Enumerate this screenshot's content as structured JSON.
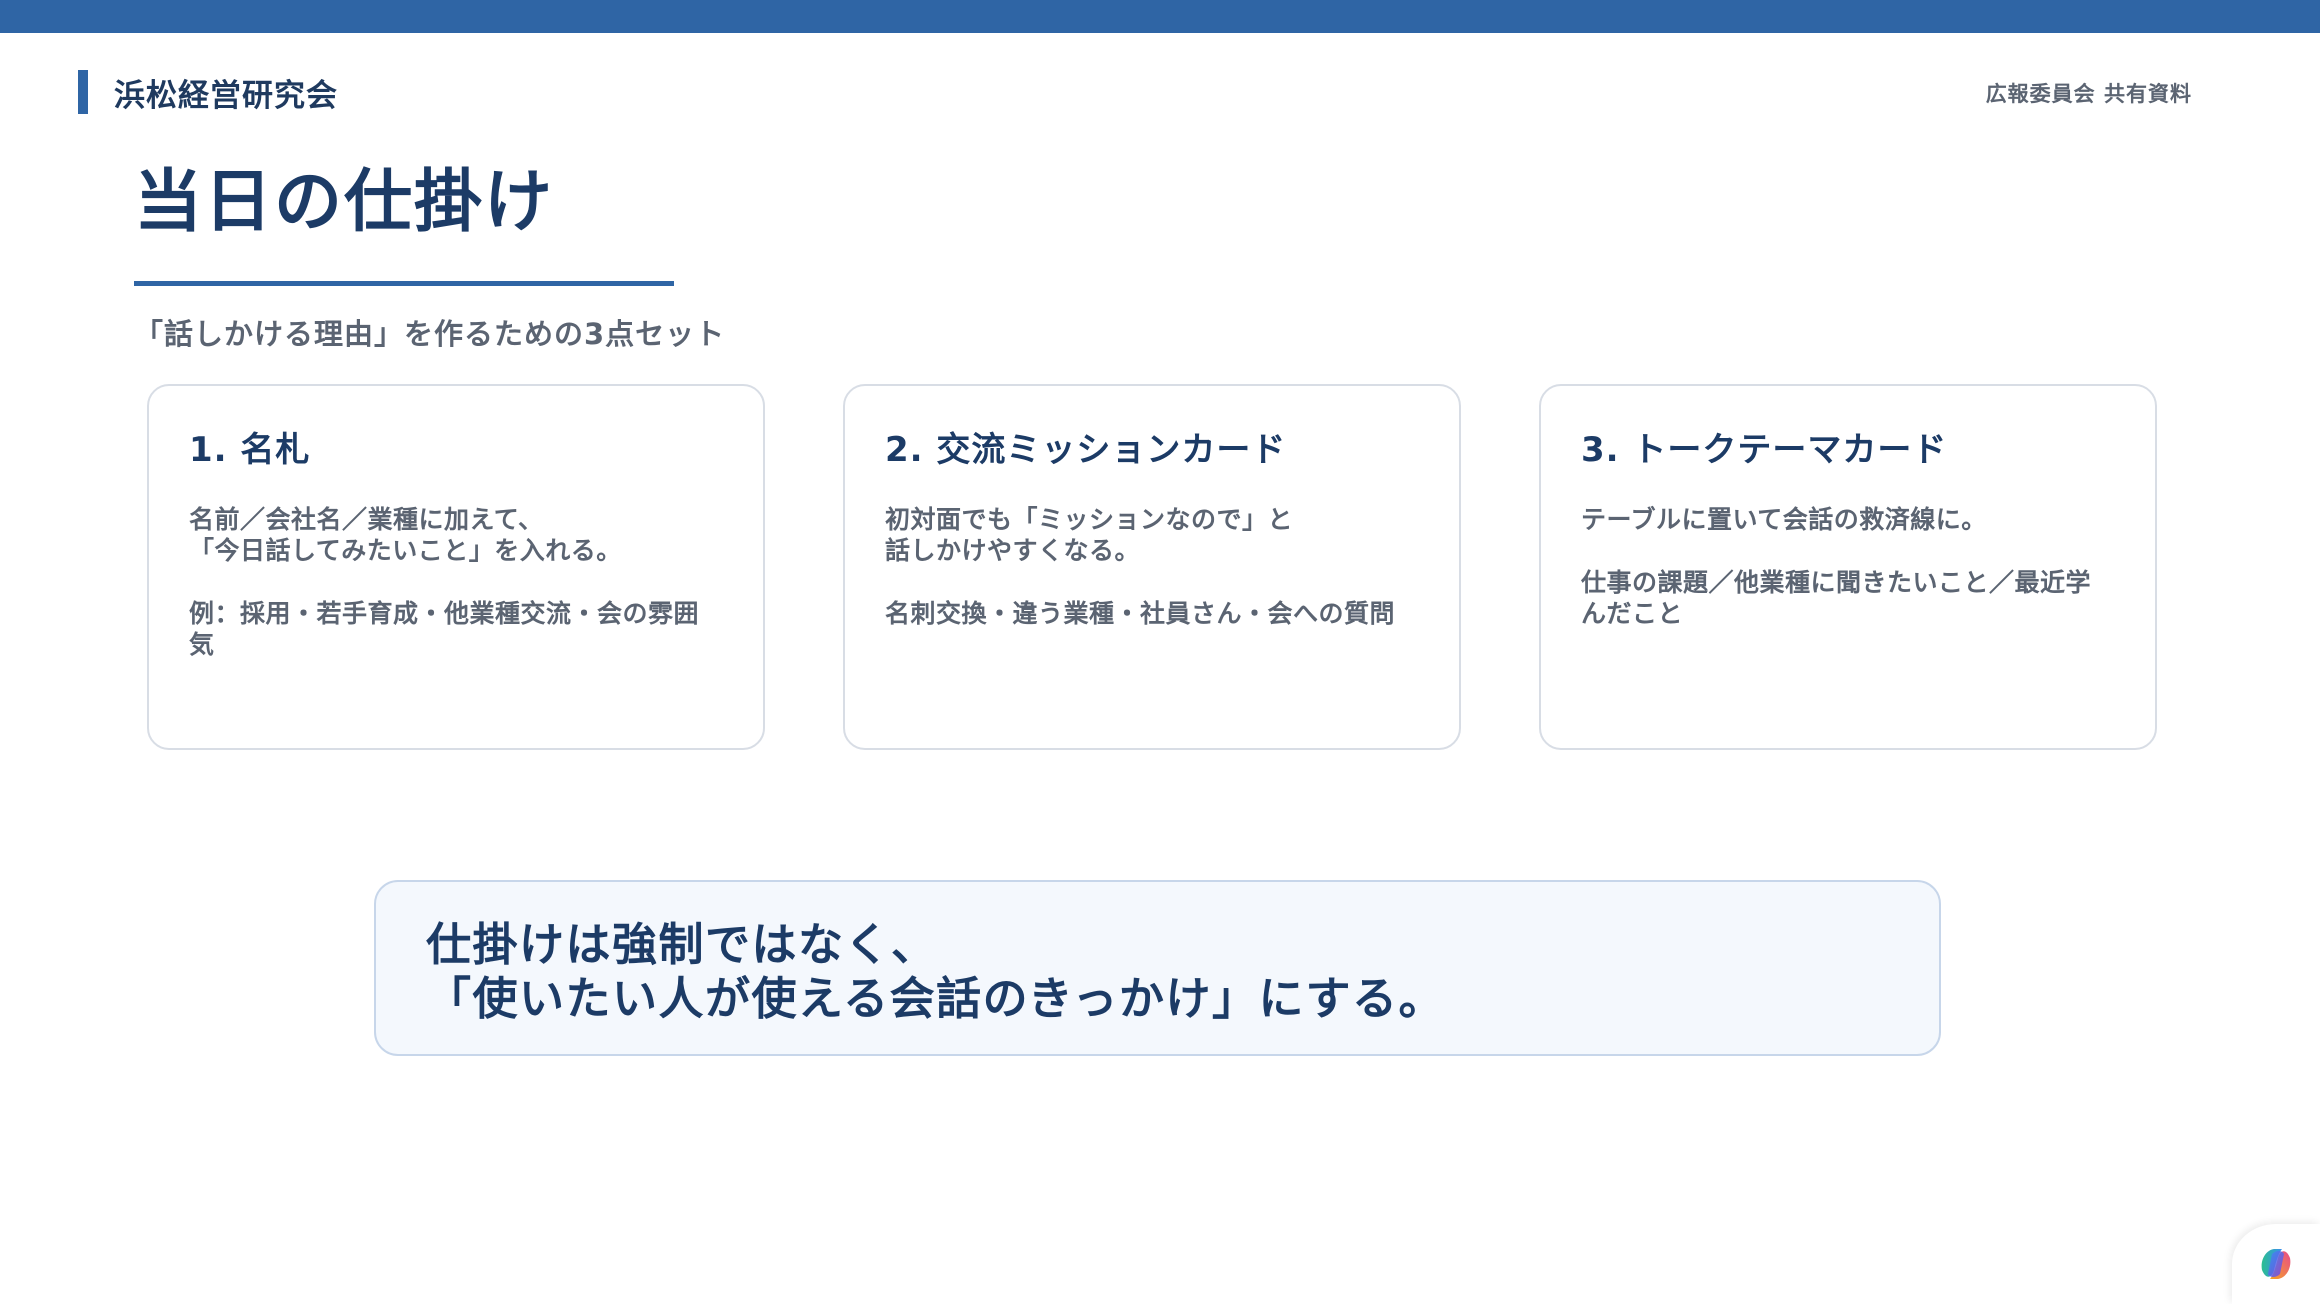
{
  "header": {
    "org_name": "浜松経営研究会",
    "doc_label": "広報委員会 共有資料"
  },
  "slide": {
    "title": "当日の仕掛け",
    "subtitle": "「話しかける理由」を作るための3点セット"
  },
  "cards": [
    {
      "title": "1. 名札",
      "paragraphs": [
        [
          "名前／会社名／業種に加えて、",
          "「今日話してみたいこと」を入れる。"
        ],
        [
          "例：採用・若手育成・他業種交流・会の雰囲",
          "気"
        ]
      ]
    },
    {
      "title": "2. 交流ミッションカード",
      "paragraphs": [
        [
          "初対面でも「ミッションなので」と",
          "話しかけやすくなる。"
        ],
        [
          "名刺交換・違う業種・社員さん・会への質問"
        ]
      ]
    },
    {
      "title": "3. トークテーマカード",
      "paragraphs": [
        [
          "テーブルに置いて会話の救済線に。"
        ],
        [
          "仕事の課題／他業種に聞きたいこと／最近学",
          "んだこと"
        ]
      ]
    }
  ],
  "callout": {
    "line1": "仕掛けは強制ではなく、",
    "line2": "「使いたい人が使える会話のきっかけ」にする。"
  },
  "colors": {
    "primary": "#2f65a5",
    "heading": "#1c3b66",
    "body_text": "#5b6472",
    "callout_bg": "#f4f8fd"
  },
  "icons": {
    "corner": "copilot-icon"
  }
}
